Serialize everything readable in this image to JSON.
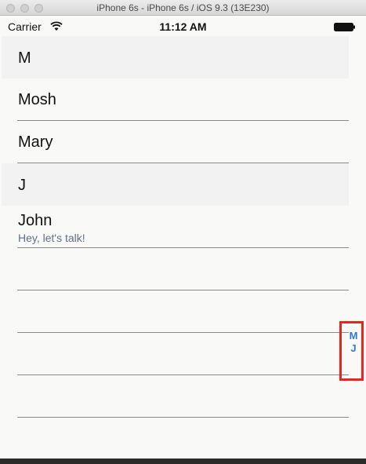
{
  "window": {
    "title": "iPhone 6s - iPhone 6s / iOS 9.3 (13E230)"
  },
  "status_bar": {
    "carrier": "Carrier",
    "time": "11:12 AM"
  },
  "sections": [
    {
      "header": "M",
      "rows": [
        {
          "title": "Mosh",
          "subtitle": ""
        },
        {
          "title": "Mary",
          "subtitle": ""
        }
      ]
    },
    {
      "header": "J",
      "rows": [
        {
          "title": "John",
          "subtitle": "Hey, let's talk!"
        }
      ]
    }
  ],
  "index_titles": [
    "M",
    "J"
  ],
  "colors": {
    "index_accent": "#2f7bd6",
    "subtitle": "#5f7089",
    "highlight_box": "#e8271b",
    "section_header_bg": "#f2f2f2"
  }
}
